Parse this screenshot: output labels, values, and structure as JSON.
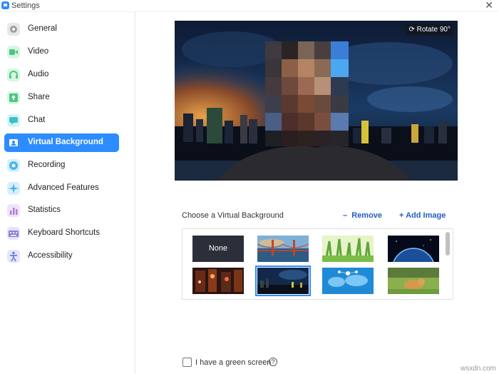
{
  "window": {
    "title": "Settings",
    "close_glyph": "✕"
  },
  "sidebar": {
    "items": [
      {
        "label": "General",
        "icon": "gear-icon",
        "color": "#9b9ba3",
        "active": false
      },
      {
        "label": "Video",
        "icon": "video-icon",
        "color": "#49c97c",
        "active": false
      },
      {
        "label": "Audio",
        "icon": "headphones-icon",
        "color": "#49c97c",
        "active": false
      },
      {
        "label": "Share",
        "icon": "share-screen-icon",
        "color": "#49c97c",
        "active": false
      },
      {
        "label": "Chat",
        "icon": "chat-icon",
        "color": "#3cc1c8",
        "active": false
      },
      {
        "label": "Virtual Background",
        "icon": "person-card-icon",
        "color": "#2d8cff",
        "active": true
      },
      {
        "label": "Recording",
        "icon": "record-icon",
        "color": "#43b8f0",
        "active": false
      },
      {
        "label": "Advanced Features",
        "icon": "sparkle-icon",
        "color": "#43b8f0",
        "active": false
      },
      {
        "label": "Statistics",
        "icon": "bar-chart-icon",
        "color": "#b07fd6",
        "active": false
      },
      {
        "label": "Keyboard Shortcuts",
        "icon": "keyboard-icon",
        "color": "#8d7fd6",
        "active": false
      },
      {
        "label": "Accessibility",
        "icon": "accessibility-icon",
        "color": "#6b7fd6",
        "active": false
      }
    ]
  },
  "preview": {
    "rotate_label": "Rotate 90°"
  },
  "choose": {
    "label": "Choose a Virtual Background",
    "remove_label": "Remove",
    "add_label": "Add Image"
  },
  "thumbnails": [
    {
      "name": "none",
      "label": "None"
    },
    {
      "name": "golden-gate-bridge"
    },
    {
      "name": "grass"
    },
    {
      "name": "earth-from-space"
    },
    {
      "name": "city-street-night"
    },
    {
      "name": "night-city-skyline",
      "selected": true
    },
    {
      "name": "world-map-network"
    },
    {
      "name": "dog-on-lawn"
    }
  ],
  "green_screen": {
    "label": "I have a green screen",
    "checked": false
  },
  "watermark": "wsxdn.com",
  "colors": {
    "accent": "#2d8cff",
    "link": "#1f5fbf"
  }
}
